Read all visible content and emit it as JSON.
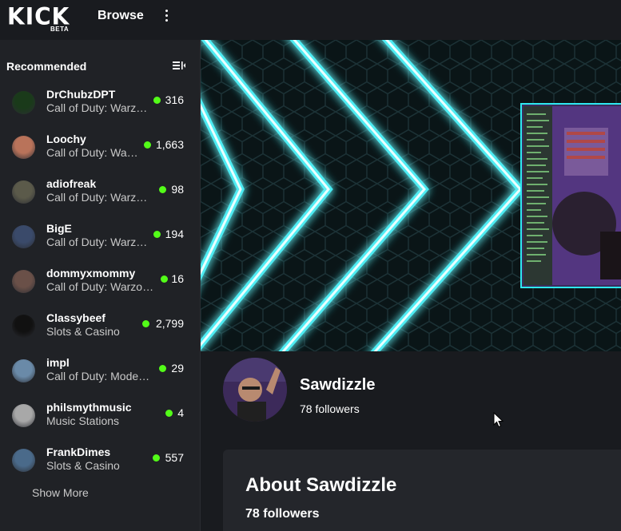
{
  "header": {
    "logo_text": "KICK",
    "logo_badge": "BETA",
    "browse_label": "Browse",
    "more_icon": "kebab-menu-icon"
  },
  "sidebar": {
    "title": "Recommended",
    "collapse_icon": "collapse-sidebar-icon",
    "items": [
      {
        "name": "DrChubzDPT",
        "category": "Call of Duty: Warz…",
        "viewers": "316",
        "avatar_color": "#1a3a1a"
      },
      {
        "name": "Loochy",
        "category": "Call of Duty: Wa…",
        "viewers": "1,663",
        "avatar_color": "#b9735a"
      },
      {
        "name": "adiofreak",
        "category": "Call of Duty: Warz…",
        "viewers": "98",
        "avatar_color": "#5b5a4a"
      },
      {
        "name": "BigE",
        "category": "Call of Duty: Warz…",
        "viewers": "194",
        "avatar_color": "#3a4a6a"
      },
      {
        "name": "dommyxmommy",
        "category": "Call of Duty: Warzo…",
        "viewers": "16",
        "avatar_color": "#6a5048"
      },
      {
        "name": "Classybeef",
        "category": "Slots & Casino",
        "viewers": "2,799",
        "avatar_color": "#111111"
      },
      {
        "name": "impl",
        "category": "Call of Duty: Mode…",
        "viewers": "29",
        "avatar_color": "#6a8aa8"
      },
      {
        "name": "philsmythmusic",
        "category": "Music Stations",
        "viewers": "4",
        "avatar_color": "#a8a8a8"
      },
      {
        "name": "FrankDimes",
        "category": "Slots & Casino",
        "viewers": "557",
        "avatar_color": "#4a6a8a"
      }
    ],
    "show_more": "Show More"
  },
  "channel": {
    "name": "Sawdizzle",
    "followers": "78 followers",
    "about_title": "About Sawdizzle",
    "about_followers": "78 followers"
  },
  "colors": {
    "live": "#53fc18",
    "neon": "#2ee8f0",
    "sidebar_bg": "#202226",
    "page_bg": "#191b1f"
  }
}
